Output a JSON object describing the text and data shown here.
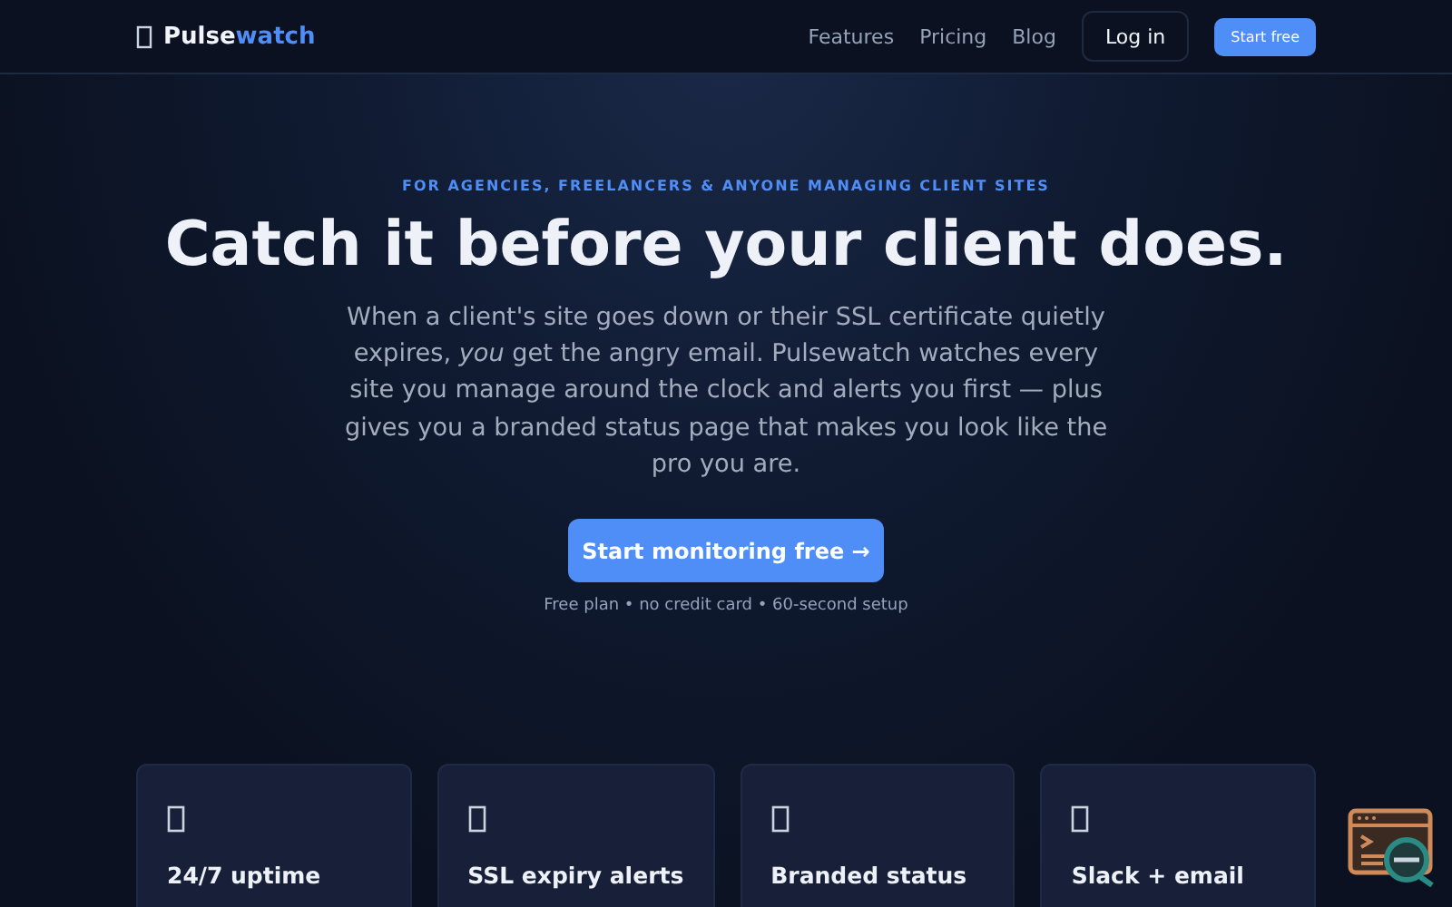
{
  "nav": {
    "logo": {
      "lead": "Pulse",
      "accent": "watch"
    },
    "links": [
      "Features",
      "Pricing",
      "Blog"
    ],
    "login": "Log in",
    "cta": "Start free"
  },
  "hero": {
    "eyebrow": "FOR AGENCIES, FREELANCERS & ANYONE MANAGING CLIENT SITES",
    "title": "Catch it before your client does.",
    "text": "When a client's site goes down or their SSL certificate quietly expires, *you* get the angry email. Pulsewatch watches every site you manage around the clock and alerts you first — plus gives you a branded status page that makes you look like the pro you are.",
    "button": "Start monitoring free →",
    "note": "Free plan • no credit card • 60-second setup"
  },
  "features": [
    {
      "title": "24/7 uptime"
    },
    {
      "title": "SSL expiry alerts"
    },
    {
      "title": "Branded status"
    },
    {
      "title": "Slack + email"
    }
  ]
}
